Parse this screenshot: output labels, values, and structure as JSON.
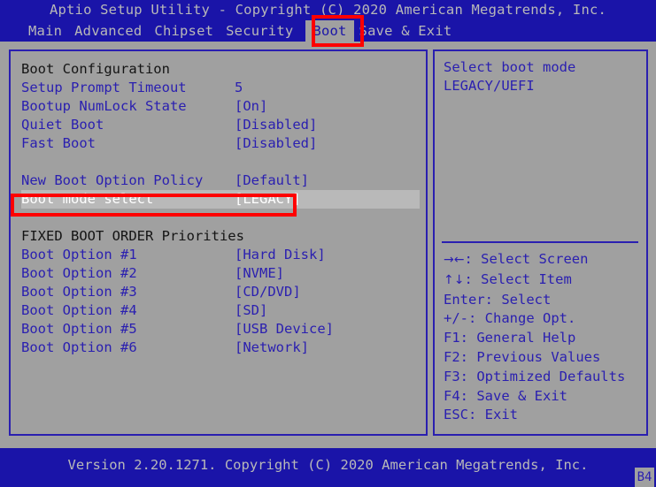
{
  "window": {
    "title": "Aptio Setup Utility - Copyright (C) 2020 American Megatrends, Inc.",
    "footer_version": "Version 2.20.1271. Copyright (C) 2020 American Megatrends, Inc.",
    "corner_badge": "B4"
  },
  "colors": {
    "title_bar_bg": "#1a14a8",
    "body_bg": "#a0a0a0",
    "text_blue": "#2a1fb0",
    "text_gray": "#b8b8b8",
    "section_header": "#141414",
    "selected_bg": "#b9b9b9",
    "selected_text": "#ffffff",
    "annotation_red": "#ff0000",
    "active_tab_bg": "#a0a0a0"
  },
  "menu": {
    "items": [
      {
        "label": "Main",
        "active": false
      },
      {
        "label": "Advanced",
        "active": false
      },
      {
        "label": "Chipset",
        "active": false
      },
      {
        "label": "Security",
        "active": false
      },
      {
        "label": "Boot",
        "active": true
      },
      {
        "label": "Save & Exit",
        "active": false
      }
    ]
  },
  "main": {
    "rows": [
      {
        "type": "section",
        "label": "Boot Configuration",
        "value": ""
      },
      {
        "type": "item",
        "label": "Setup Prompt Timeout",
        "value": "5"
      },
      {
        "type": "item",
        "label": "Bootup NumLock State",
        "value": "[On]"
      },
      {
        "type": "item",
        "label": "Quiet Boot",
        "value": "[Disabled]"
      },
      {
        "type": "item",
        "label": "Fast Boot",
        "value": "[Disabled]"
      },
      {
        "type": "spacer",
        "label": "",
        "value": ""
      },
      {
        "type": "item",
        "label": "New Boot Option Policy",
        "value": "[Default]"
      },
      {
        "type": "selected",
        "label": "Boot mode select",
        "value": "[LEGACY]"
      },
      {
        "type": "spacer",
        "label": "",
        "value": ""
      },
      {
        "type": "section",
        "label": "FIXED BOOT ORDER Priorities",
        "value": ""
      },
      {
        "type": "item",
        "label": "Boot Option #1",
        "value": "[Hard Disk]"
      },
      {
        "type": "item",
        "label": "Boot Option #2",
        "value": "[NVME]"
      },
      {
        "type": "item",
        "label": "Boot Option #3",
        "value": "[CD/DVD]"
      },
      {
        "type": "item",
        "label": "Boot Option #4",
        "value": "[SD]"
      },
      {
        "type": "item",
        "label": "Boot Option #5",
        "value": "[USB Device]"
      },
      {
        "type": "item",
        "label": "Boot Option #6",
        "value": "[Network]"
      }
    ]
  },
  "help": {
    "lines": [
      "Select boot mode",
      "LEGACY/UEFI"
    ]
  },
  "keys": {
    "items": [
      {
        "key": "→←",
        "desc": ": Select Screen"
      },
      {
        "key": "↑↓",
        "desc": ": Select Item"
      },
      {
        "key": "Enter",
        "desc": ": Select"
      },
      {
        "key": "+/-",
        "desc": ": Change Opt."
      },
      {
        "key": "F1",
        "desc": ": General Help"
      },
      {
        "key": "F2",
        "desc": ": Previous Values"
      },
      {
        "key": "F3",
        "desc": ": Optimized Defaults"
      },
      {
        "key": "F4",
        "desc": ": Save & Exit"
      },
      {
        "key": "ESC",
        "desc": ": Exit"
      }
    ]
  },
  "annotations": [
    {
      "name": "boot-tab-highlight",
      "target": "Boot"
    },
    {
      "name": "boot-mode-select-highlight",
      "target": "Boot mode select"
    }
  ]
}
